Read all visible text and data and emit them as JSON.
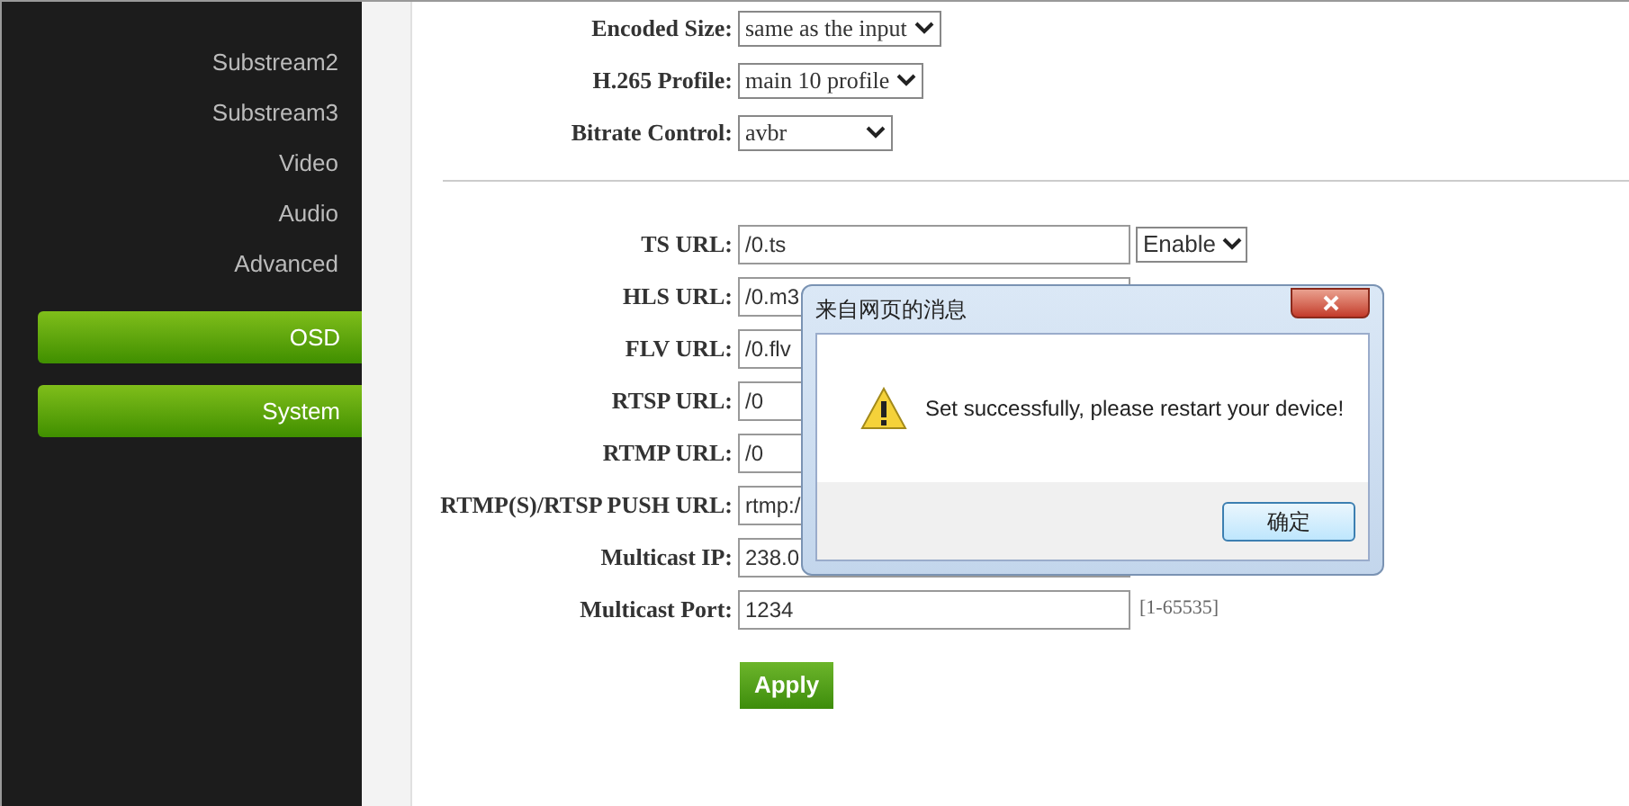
{
  "sidebar": {
    "items": [
      {
        "label": "Substream2",
        "kind": "link"
      },
      {
        "label": "Substream3",
        "kind": "link"
      },
      {
        "label": "Video",
        "kind": "link"
      },
      {
        "label": "Audio",
        "kind": "link"
      },
      {
        "label": "Advanced",
        "kind": "link"
      },
      {
        "label": "OSD",
        "kind": "button"
      },
      {
        "label": "System",
        "kind": "button"
      }
    ]
  },
  "encoding": [
    {
      "label": "Encoded Size:",
      "value": "same as the input"
    },
    {
      "label": "H.265 Profile:",
      "value": "main 10 profile"
    },
    {
      "label": "Bitrate Control:",
      "value": "avbr"
    }
  ],
  "streams": [
    {
      "label": "TS URL:",
      "value": "/0.ts",
      "select": "Enable"
    },
    {
      "label": "HLS URL:",
      "value": "/0.m3"
    },
    {
      "label": "FLV URL:",
      "value": "/0.flv"
    },
    {
      "label": "RTSP URL:",
      "value": "/0"
    },
    {
      "label": "RTMP URL:",
      "value": "/0"
    },
    {
      "label": "RTMP(S)/RTSP PUSH URL:",
      "value": "rtmp:/"
    },
    {
      "label": "Multicast IP:",
      "value": "238.0"
    },
    {
      "label": "Multicast Port:",
      "value": "1234",
      "hint": "[1-65535]"
    }
  ],
  "apply_button": "Apply",
  "dialog": {
    "title": "来自网页的消息",
    "message": "Set successfully, please restart your device!",
    "ok_button": "确定"
  }
}
